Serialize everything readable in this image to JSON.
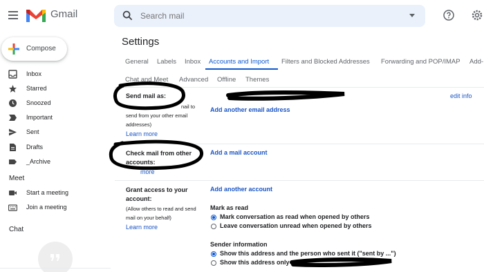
{
  "app": {
    "name": "Gmail"
  },
  "search": {
    "placeholder": "Search mail"
  },
  "nav": {
    "compose": "Compose",
    "items": [
      {
        "label": "Inbox",
        "icon": "inbox-icon"
      },
      {
        "label": "Starred",
        "icon": "star-icon"
      },
      {
        "label": "Snoozed",
        "icon": "clock-icon"
      },
      {
        "label": "Important",
        "icon": "important-icon"
      },
      {
        "label": "Sent",
        "icon": "send-icon"
      },
      {
        "label": "Drafts",
        "icon": "draft-icon"
      },
      {
        "label": "_Archive",
        "icon": "label-icon"
      }
    ],
    "meet": {
      "title": "Meet",
      "items": [
        {
          "label": "Start a meeting",
          "icon": "video-icon"
        },
        {
          "label": "Join a meeting",
          "icon": "keyboard-icon"
        }
      ]
    },
    "chat": {
      "title": "Chat"
    }
  },
  "settings": {
    "title": "Settings",
    "tabs": [
      {
        "label": "General"
      },
      {
        "label": "Labels"
      },
      {
        "label": "Inbox"
      },
      {
        "label": "Accounts and Import",
        "active": true
      },
      {
        "label": "Filters and Blocked Addresses"
      },
      {
        "label": "Forwarding and POP/IMAP"
      },
      {
        "label": "Add-"
      },
      {
        "label": "Chat and Meet"
      },
      {
        "label": "Advanced"
      },
      {
        "label": "Offline"
      },
      {
        "label": "Themes"
      }
    ],
    "send_mail": {
      "label": "Send mail as:",
      "desc_1": "nail to",
      "desc_2": "send from your other email",
      "desc_3": "addresses)",
      "learn_more": "Learn more",
      "add_link": "Add another email address",
      "edit_link": "edit info"
    },
    "check_mail": {
      "label_1": "Check mail from other",
      "label_2": "accounts:",
      "learn_more": "more",
      "add_link": "Add a mail account"
    },
    "grant_access": {
      "label_1": "Grant access to your",
      "label_2": "account:",
      "desc_1": "(Allow others to read and send",
      "desc_2": "mail on your behalf)",
      "learn_more": "Learn more",
      "add_link": "Add another account",
      "mark_as_read": {
        "title": "Mark as read",
        "options": [
          {
            "label": "Mark conversation as read when opened by others",
            "selected": true
          },
          {
            "label": "Leave conversation unread when opened by others",
            "selected": false
          }
        ]
      },
      "sender_info": {
        "title": "Sender information",
        "options": [
          {
            "label": "Show this address and the person who sent it (\"sent by ...\")",
            "selected": true
          },
          {
            "label": "Show this address only",
            "selected": false
          }
        ]
      }
    }
  },
  "colors": {
    "accent": "#0b57d0",
    "link": "#1a55c4",
    "search_bg": "#eaf1fb",
    "annotation": "#000000"
  }
}
